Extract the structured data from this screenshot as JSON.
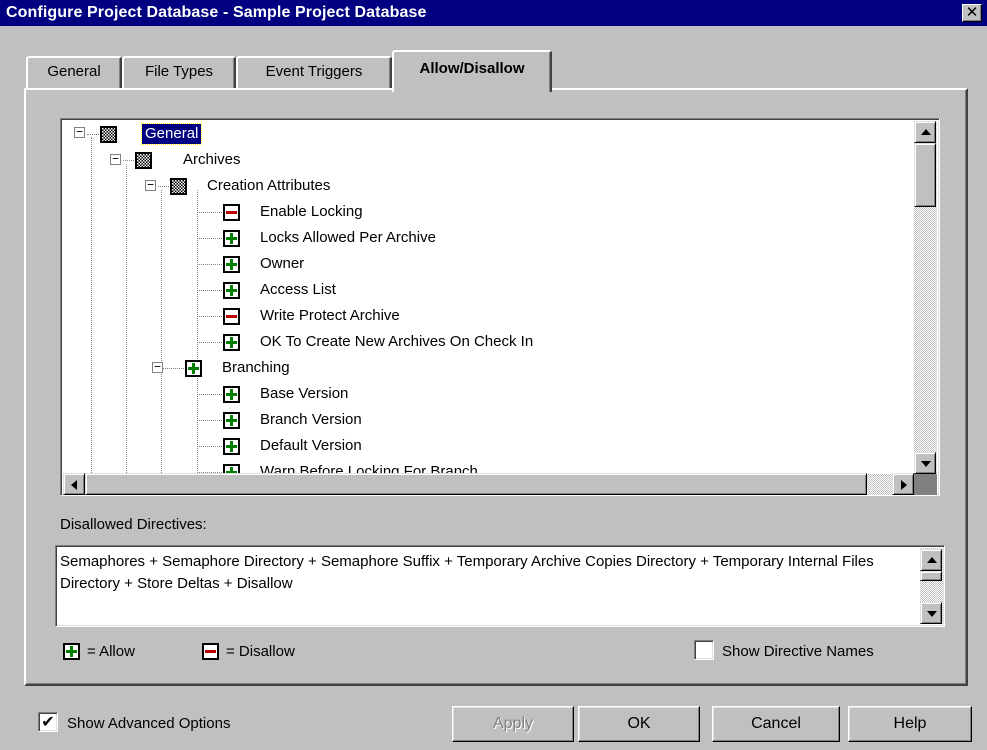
{
  "window": {
    "title": "Configure Project Database - Sample Project Database",
    "close_glyph": "✕"
  },
  "tabs": [
    {
      "label": "General"
    },
    {
      "label": "File Types"
    },
    {
      "label": "Event Triggers"
    },
    {
      "label": "Allow/Disallow",
      "active": true
    }
  ],
  "tree": {
    "items": [
      {
        "label": "General",
        "icon": "mixed-state-icon",
        "selected": true
      },
      {
        "label": "Archives",
        "icon": "mixed-state-icon"
      },
      {
        "label": "Creation Attributes",
        "icon": "mixed-state-icon"
      },
      {
        "label": "Enable Locking",
        "icon": "disallow-icon"
      },
      {
        "label": "Locks Allowed Per Archive",
        "icon": "allow-icon"
      },
      {
        "label": "Owner",
        "icon": "allow-icon"
      },
      {
        "label": "Access List",
        "icon": "allow-icon"
      },
      {
        "label": "Write Protect Archive",
        "icon": "disallow-icon"
      },
      {
        "label": "OK To Create New Archives On Check In",
        "icon": "allow-icon"
      },
      {
        "label": "Branching",
        "icon": "allow-icon"
      },
      {
        "label": "Base Version",
        "icon": "allow-icon"
      },
      {
        "label": "Branch Version",
        "icon": "allow-icon"
      },
      {
        "label": "Default Version",
        "icon": "allow-icon"
      },
      {
        "label": "Warn Before Locking For Branch",
        "icon": "allow-icon"
      }
    ]
  },
  "disallowed": {
    "label": "Disallowed Directives:",
    "text": "Semaphores + Semaphore Directory + Semaphore Suffix + Temporary Archive Copies Directory + Temporary Internal Files Directory + Store Deltas + Disallow"
  },
  "legend": {
    "allow": "= Allow",
    "disallow": "= Disallow"
  },
  "show_directive_names": {
    "label": "Show Directive Names",
    "checked": false
  },
  "show_advanced": {
    "label": "Show Advanced Options",
    "checked": true,
    "check_glyph": "✔"
  },
  "buttons": {
    "apply": "Apply",
    "ok": "OK",
    "cancel": "Cancel",
    "help": "Help"
  },
  "colors": {
    "title_bar": "#000080",
    "allow": "#008000",
    "disallow": "#c00000",
    "face": "#c0c0c0"
  }
}
